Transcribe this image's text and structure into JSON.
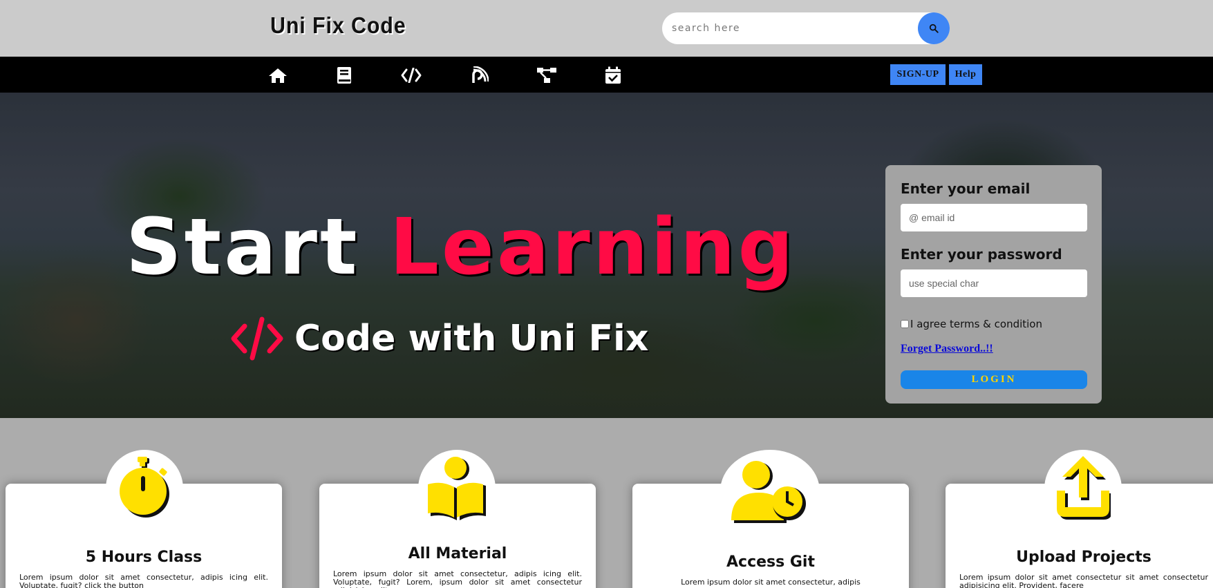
{
  "header": {
    "logo": "Uni Fix Code",
    "search_placeholder": "search here",
    "search_icon": "search-icon"
  },
  "nav": {
    "icons": [
      "home-icon",
      "book-icon",
      "code-icon",
      "blog-icon",
      "sitemap-icon",
      "calendar-check-icon"
    ],
    "signup_label": "SIGN-UP",
    "help_label": "Help"
  },
  "hero": {
    "title_word1": "Start",
    "title_word2": "Learning",
    "subtitle": "Code with Uni Fix",
    "accent_color": "#ff0b45"
  },
  "login": {
    "email_label": "Enter your email",
    "email_placeholder": "@ email id",
    "password_label": "Enter your password",
    "password_placeholder": "use special char",
    "agree_label": "I agree terms & condition",
    "forget_label": "Forget Password..!!",
    "login_label": "LOGIN"
  },
  "cards": [
    {
      "title": "5 Hours Class",
      "icon": "stopwatch-icon",
      "text": "Lorem ipsum dolor sit amet consectetur, adipis icing elit. Voluptate, fugit? click the button"
    },
    {
      "title": "All Material",
      "icon": "reading-icon",
      "text": "Lorem ipsum dolor sit amet consectetur, adipis icing elit. Voluptate, fugit? Lorem, ipsum dolor sit amet consectetur adipisicing elit."
    },
    {
      "title": "Access Git",
      "icon": "user-clock-icon",
      "text": "Lorem ipsum dolor sit amet consectetur, adipis"
    },
    {
      "title": "Upload Projects",
      "icon": "upload-icon",
      "text": "Lorem ipsum dolor sit amet consectetur sit amet consectetur adipisicing elit. Provident, facere"
    }
  ],
  "colors": {
    "header_bg": "#cbcbcb",
    "nav_bg": "#000000",
    "button_blue": "#3f86f5",
    "icon_yellow": "#ffe000"
  }
}
